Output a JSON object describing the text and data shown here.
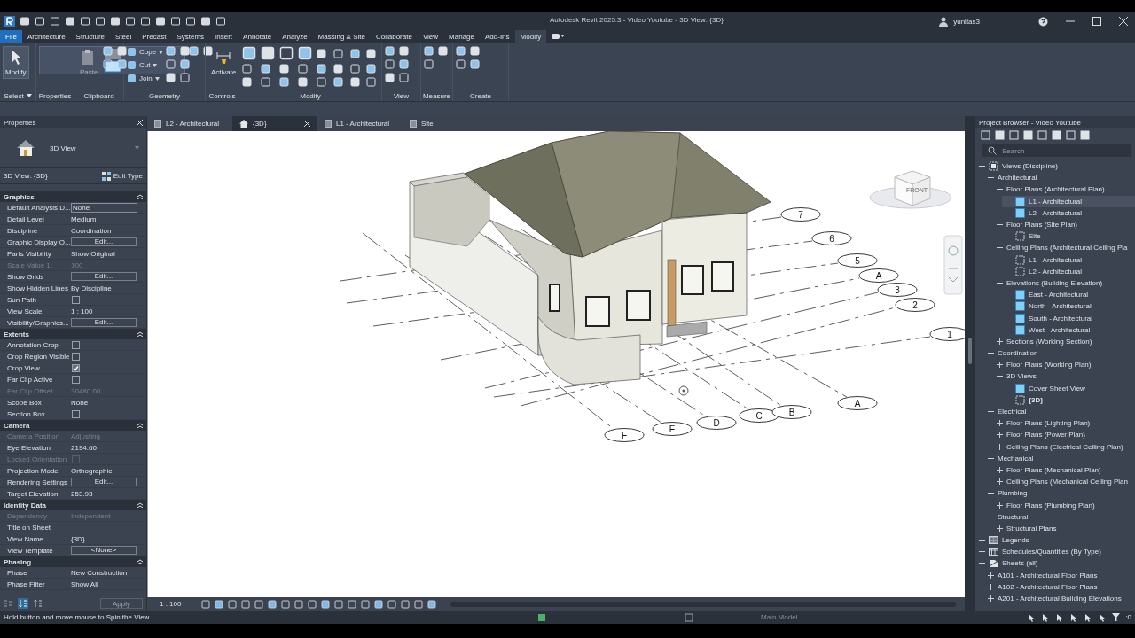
{
  "title_bar": {
    "title": "Autodesk Revit 2025.3 - Video Youtube - 3D View: {3D}",
    "user": "yunitas3"
  },
  "menu_tabs": [
    {
      "label": "File",
      "kind": "file",
      "selected": false
    },
    {
      "label": "Architecture",
      "kind": "tab",
      "selected": false
    },
    {
      "label": "Structure",
      "kind": "tab",
      "selected": false
    },
    {
      "label": "Steel",
      "kind": "tab",
      "selected": false
    },
    {
      "label": "Precast",
      "kind": "tab",
      "selected": false
    },
    {
      "label": "Systems",
      "kind": "tab",
      "selected": false
    },
    {
      "label": "Insert",
      "kind": "tab",
      "selected": false
    },
    {
      "label": "Annotate",
      "kind": "tab",
      "selected": false
    },
    {
      "label": "Analyze",
      "kind": "tab",
      "selected": false
    },
    {
      "label": "Massing & Site",
      "kind": "tab",
      "selected": false
    },
    {
      "label": "Collaborate",
      "kind": "tab",
      "selected": false
    },
    {
      "label": "View",
      "kind": "tab",
      "selected": false
    },
    {
      "label": "Manage",
      "kind": "tab",
      "selected": false
    },
    {
      "label": "Add-Ins",
      "kind": "tab",
      "selected": false
    },
    {
      "label": "Modify",
      "kind": "tab",
      "selected": true
    }
  ],
  "ribbon_panels": [
    {
      "title": "Select",
      "large": [
        {
          "label": "Modify",
          "selected": true,
          "disabled": false
        }
      ]
    },
    {
      "title": "Properties"
    },
    {
      "title": "Clipboard",
      "large": [
        {
          "label": "Paste",
          "selected": false,
          "disabled": true
        }
      ]
    },
    {
      "title": "Geometry",
      "small": [
        "Cope",
        "Cut",
        "Join"
      ]
    },
    {
      "title": "Controls",
      "large": [
        {
          "label": "Activate",
          "selected": false,
          "disabled": false
        }
      ]
    },
    {
      "title": "Modify"
    },
    {
      "title": "View"
    },
    {
      "title": "Measure"
    },
    {
      "title": "Create"
    }
  ],
  "properties": {
    "title": "Properties",
    "type_name": "3D View",
    "instance": "3D View: {3D}",
    "edit_type": "Edit Type",
    "sections": [
      {
        "title": "Graphics",
        "expanded": true,
        "rows": [
          {
            "label": "Default Analysis D...",
            "value": "None",
            "kind": "field",
            "disabled": false
          },
          {
            "label": "Detail Level",
            "value": "Medium",
            "kind": "text",
            "disabled": false
          },
          {
            "label": "Discipline",
            "value": "Coordination",
            "kind": "text",
            "disabled": false
          },
          {
            "label": "Graphic Display O...",
            "value": "Edit...",
            "kind": "button",
            "disabled": false
          },
          {
            "label": "Parts Visibility",
            "value": "Show Original",
            "kind": "text",
            "disabled": false
          },
          {
            "label": "Scale Value    1:",
            "value": "100",
            "kind": "text",
            "disabled": true
          },
          {
            "label": "Show Grids",
            "value": "Edit...",
            "kind": "button",
            "disabled": false
          },
          {
            "label": "Show Hidden Lines",
            "value": "By Discipline",
            "kind": "text",
            "disabled": false
          },
          {
            "label": "Sun Path",
            "kind": "checkbox",
            "checked": false,
            "disabled": false
          },
          {
            "label": "View Scale",
            "value": "1 : 100",
            "kind": "text",
            "disabled": false
          },
          {
            "label": "Visibility/Graphics...",
            "value": "Edit...",
            "kind": "button",
            "disabled": false
          }
        ]
      },
      {
        "title": "Extents",
        "expanded": true,
        "rows": [
          {
            "label": "Annotation Crop",
            "kind": "checkbox",
            "checked": false,
            "disabled": false
          },
          {
            "label": "Crop Region Visible",
            "kind": "checkbox",
            "checked": false,
            "disabled": false
          },
          {
            "label": "Crop View",
            "kind": "checkbox",
            "checked": true,
            "disabled": false
          },
          {
            "label": "Far Clip Active",
            "kind": "checkbox",
            "checked": false,
            "disabled": false
          },
          {
            "label": "Far Clip Offset",
            "value": "30480.00",
            "kind": "text",
            "disabled": true
          },
          {
            "label": "Scope Box",
            "value": "None",
            "kind": "text",
            "disabled": false
          },
          {
            "label": "Section Box",
            "kind": "checkbox",
            "checked": false,
            "disabled": false
          }
        ]
      },
      {
        "title": "Camera",
        "expanded": true,
        "rows": [
          {
            "label": "Camera Position",
            "value": "Adjusting",
            "kind": "text",
            "disabled": true
          },
          {
            "label": "Eye Elevation",
            "value": "2194.60",
            "kind": "text",
            "disabled": false
          },
          {
            "label": "Locked Orientation",
            "kind": "checkbox",
            "checked": false,
            "disabled": true
          },
          {
            "label": "Projection Mode",
            "value": "Orthographic",
            "kind": "text",
            "disabled": false
          },
          {
            "label": "Rendering Settings",
            "value": "Edit...",
            "kind": "button",
            "disabled": false
          },
          {
            "label": "Target Elevation",
            "value": "253.93",
            "kind": "text",
            "disabled": false
          }
        ]
      },
      {
        "title": "Identity Data",
        "expanded": true,
        "rows": [
          {
            "label": "Dependency",
            "value": "Independent",
            "kind": "text",
            "disabled": true
          },
          {
            "label": "Title on Sheet",
            "kind": "text",
            "disabled": false
          },
          {
            "label": "View Name",
            "value": "{3D}",
            "kind": "text",
            "disabled": false
          },
          {
            "label": "View Template",
            "value": "<None>",
            "kind": "button",
            "disabled": false
          }
        ]
      },
      {
        "title": "Phasing",
        "expanded": true,
        "rows": [
          {
            "label": "Phase",
            "value": "New Construction",
            "kind": "text",
            "disabled": false
          },
          {
            "label": "Phase Filter",
            "value": "Show All",
            "kind": "text",
            "disabled": false
          }
        ]
      }
    ],
    "apply": {
      "label": "Apply",
      "disabled": true
    }
  },
  "view_tabs": [
    {
      "label": "L2 - Architectural",
      "kind": "plan",
      "selected": false
    },
    {
      "label": "{3D}",
      "kind": "model",
      "selected": true
    },
    {
      "label": "L1 - Architectural",
      "kind": "plan",
      "selected": false
    },
    {
      "label": "Site",
      "kind": "plan",
      "selected": false
    }
  ],
  "viewport": {
    "view_cube_face": "FRONT",
    "grid_bubbles": [
      "7",
      "6",
      "5",
      "A",
      "3",
      "2",
      "1",
      "F",
      "E",
      "D",
      "C",
      "B",
      "A"
    ]
  },
  "view_control": {
    "scale": "1 : 100"
  },
  "browser": {
    "title": "Project Browser - Video Youtube",
    "search_placeholder": "Search",
    "tree": [
      {
        "label": "Views (Discipline)",
        "kind": "root_views",
        "expanded": true,
        "selected": false,
        "children": [
          {
            "label": "Architectural",
            "expanded": true,
            "selected": false,
            "children": [
              {
                "label": "Floor Plans (Architectural Plan)",
                "expanded": true,
                "selected": false,
                "children": [
                  {
                    "label": "L1 - Architectural",
                    "kind": "view_filled",
                    "selected": true,
                    "current": false
                  },
                  {
                    "label": "L2 - Architectural",
                    "kind": "view_filled",
                    "selected": false,
                    "current": false
                  }
                ]
              },
              {
                "label": "Floor Plans (Site Plan)",
                "expanded": true,
                "selected": false,
                "children": [
                  {
                    "label": "Site",
                    "kind": "view_outline",
                    "selected": false,
                    "current": false
                  }
                ]
              },
              {
                "label": "Ceiling Plans (Architectural Ceiling Pla",
                "expanded": true,
                "selected": false,
                "children": [
                  {
                    "label": "L1 - Architectural",
                    "kind": "view_outline",
                    "selected": false,
                    "current": false
                  },
                  {
                    "label": "L2 - Architectural",
                    "kind": "view_outline",
                    "selected": false,
                    "current": false
                  }
                ]
              },
              {
                "label": "Elevations (Building Elevation)",
                "expanded": true,
                "selected": false,
                "children": [
                  {
                    "label": "East - Architectural",
                    "kind": "view_filled",
                    "selected": false,
                    "current": false
                  },
                  {
                    "label": "North - Architectural",
                    "kind": "view_filled",
                    "selected": false,
                    "current": false
                  },
                  {
                    "label": "South - Architectural",
                    "kind": "view_filled",
                    "selected": false,
                    "current": false
                  },
                  {
                    "label": "West - Architectural",
                    "kind": "view_filled",
                    "selected": false,
                    "current": false
                  }
                ]
              },
              {
                "label": "Sections (Working Section)",
                "expanded": false,
                "selected": false
              }
            ]
          },
          {
            "label": "Coordination",
            "expanded": true,
            "selected": false,
            "children": [
              {
                "label": "Floor Plans (Working Plan)",
                "expanded": false,
                "selected": false
              },
              {
                "label": "3D Views",
                "expanded": true,
                "selected": false,
                "children": [
                  {
                    "label": "Cover Sheet View",
                    "kind": "view_filled",
                    "selected": false,
                    "current": false
                  },
                  {
                    "label": "{3D}",
                    "kind": "view_outline",
                    "selected": false,
                    "current": true
                  }
                ]
              }
            ]
          },
          {
            "label": "Electrical",
            "expanded": true,
            "selected": false,
            "children": [
              {
                "label": "Floor Plans (Lighting Plan)",
                "expanded": false,
                "selected": false
              },
              {
                "label": "Floor Plans (Power Plan)",
                "expanded": false,
                "selected": false
              },
              {
                "label": "Ceiling Plans (Electrical Ceiling Plan)",
                "expanded": false,
                "selected": false
              }
            ]
          },
          {
            "label": "Mechanical",
            "expanded": true,
            "selected": false,
            "children": [
              {
                "label": "Floor Plans (Mechanical Plan)",
                "expanded": false,
                "selected": false
              },
              {
                "label": "Ceiling Plans (Mechanical Ceiling Plan",
                "expanded": false,
                "selected": false
              }
            ]
          },
          {
            "label": "Plumbing",
            "expanded": true,
            "selected": false,
            "children": [
              {
                "label": "Floor Plans (Plumbing Plan)",
                "expanded": false,
                "selected": false
              }
            ]
          },
          {
            "label": "Structural",
            "expanded": true,
            "selected": false,
            "children": [
              {
                "label": "Structural Plans",
                "expanded": false,
                "selected": false
              }
            ]
          }
        ]
      },
      {
        "label": "Legends",
        "kind": "root_legends",
        "expanded": false,
        "selected": false
      },
      {
        "label": "Schedules/Quantities (By Type)",
        "kind": "root_schedules",
        "expanded": false,
        "selected": false
      },
      {
        "label": "Sheets (all)",
        "kind": "root_sheets",
        "expanded": true,
        "selected": false,
        "children": [
          {
            "label": "A101 - Architectural Floor Plans",
            "expanded": false,
            "selected": false
          },
          {
            "label": "A102 - Architectural Floor Plans",
            "expanded": false,
            "selected": false
          },
          {
            "label": "A201 - Architectural Building Elevations",
            "expanded": false,
            "selected": false
          }
        ]
      }
    ]
  },
  "status_bar": {
    "message": "Hold button and move mouse to Spin the View.",
    "model": "Main Model",
    "filter_count": ":0"
  }
}
